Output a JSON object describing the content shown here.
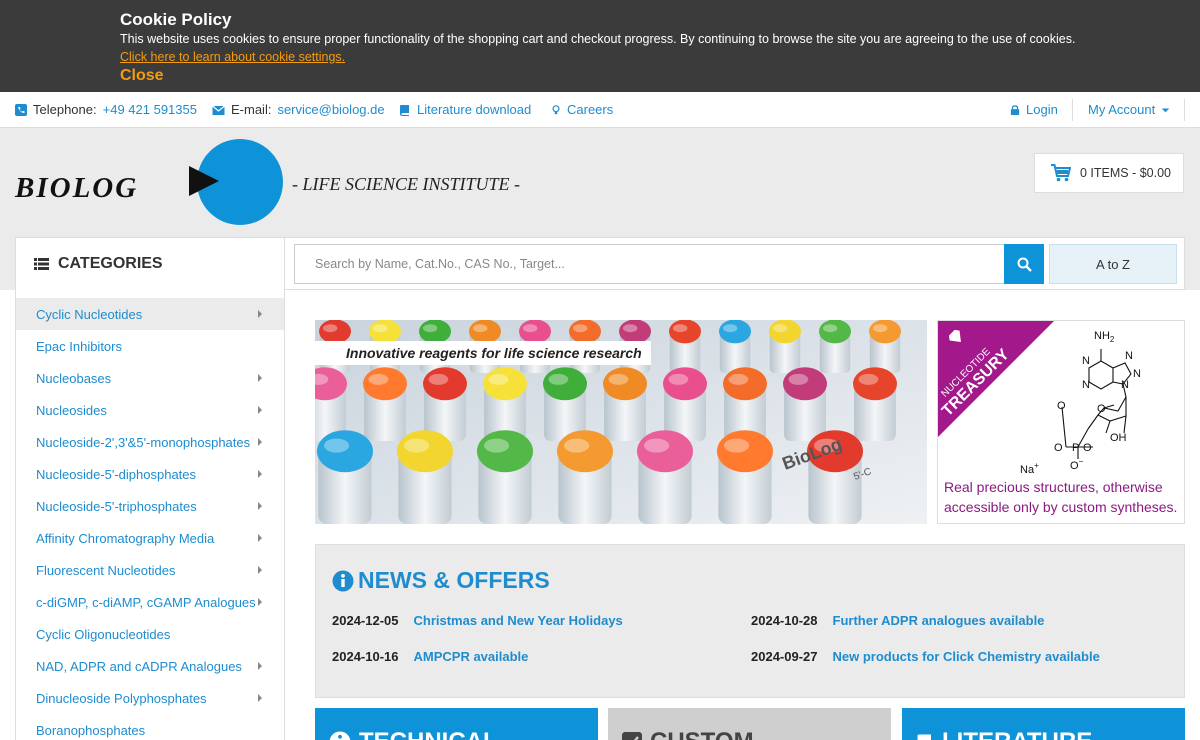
{
  "cookie": {
    "title": "Cookie Policy",
    "text": "This website uses cookies to ensure proper functionality of the shopping cart and checkout progress. By continuing to browse the site you are agreeing to the use of cookies.",
    "link": "Click here to learn about cookie settings.",
    "close": "Close"
  },
  "topbar": {
    "telephone_label": "Telephone:",
    "telephone": "+49 421 591355",
    "email_label": "E-mail:",
    "email": "service@biolog.de",
    "literature": "Literature download",
    "careers": "Careers",
    "login": "Login",
    "account": "My Account"
  },
  "header": {
    "logo": "BIOLOG",
    "tagline": "- LIFE SCIENCE INSTITUTE -",
    "cart": "0 ITEMS - $0.00"
  },
  "categories": {
    "title": "CATEGORIES",
    "items": [
      {
        "label": "Cyclic Nucleotides",
        "arrow": true,
        "active": true
      },
      {
        "label": "Epac Inhibitors",
        "arrow": false,
        "active": false
      },
      {
        "label": "Nucleobases",
        "arrow": true,
        "active": false
      },
      {
        "label": "Nucleosides",
        "arrow": true,
        "active": false
      },
      {
        "label": "Nucleoside-2',3'&5'-monophosphates",
        "arrow": true,
        "active": false
      },
      {
        "label": "Nucleoside-5'-diphosphates",
        "arrow": true,
        "active": false
      },
      {
        "label": "Nucleoside-5'-triphosphates",
        "arrow": true,
        "active": false
      },
      {
        "label": "Affinity Chromatography Media",
        "arrow": true,
        "active": false
      },
      {
        "label": "Fluorescent Nucleotides",
        "arrow": true,
        "active": false
      },
      {
        "label": "c-diGMP, c-diAMP, cGAMP Analogues",
        "arrow": true,
        "active": false
      },
      {
        "label": "Cyclic Oligonucleotides",
        "arrow": false,
        "active": false
      },
      {
        "label": "NAD, ADPR and cADPR Analogues",
        "arrow": true,
        "active": false
      },
      {
        "label": "Dinucleoside Polyphosphates",
        "arrow": true,
        "active": false
      },
      {
        "label": "Boranophosphates",
        "arrow": false,
        "active": false
      }
    ]
  },
  "search": {
    "placeholder": "Search by Name, Cat.No., CAS No., Target...",
    "atoz": "A to Z"
  },
  "banner": {
    "caption": "Innovative reagents for life science research",
    "vial_label": "BioLog",
    "vial_label_small": "5'-C"
  },
  "treasury": {
    "ribbon_top": "NUCLEOTIDE",
    "ribbon_main": "TREASURY",
    "text": "Real precious structures, otherwise accessible only by custom syntheses.",
    "atoms": {
      "nh2": "NH",
      "nh2_sub": "2",
      "n": "N",
      "o": "O",
      "p": "P",
      "oh": "OH",
      "na": "Na",
      "plus": "+",
      "minus": "−"
    }
  },
  "news": {
    "title": "NEWS & OFFERS",
    "items": [
      {
        "date": "2024-12-05",
        "title": "Christmas and New Year Holidays"
      },
      {
        "date": "2024-10-28",
        "title": "Further ADPR analogues available"
      },
      {
        "date": "2024-10-16",
        "title": "AMPCPR available"
      },
      {
        "date": "2024-09-27",
        "title": "New products for Click Chemistry available"
      }
    ]
  },
  "tiles": [
    {
      "label": "TECHNICAL",
      "color": "#0f93d8"
    },
    {
      "label": "CUSTOM",
      "color": "#cfcfcf"
    },
    {
      "label": "LITERATURE",
      "color": "#0f93d8"
    }
  ],
  "colors": {
    "brand_blue": "#0f93d8",
    "link_blue": "#1e8ccf",
    "accent_orange": "#f39c12",
    "treasury_purple": "#8b1a80"
  }
}
